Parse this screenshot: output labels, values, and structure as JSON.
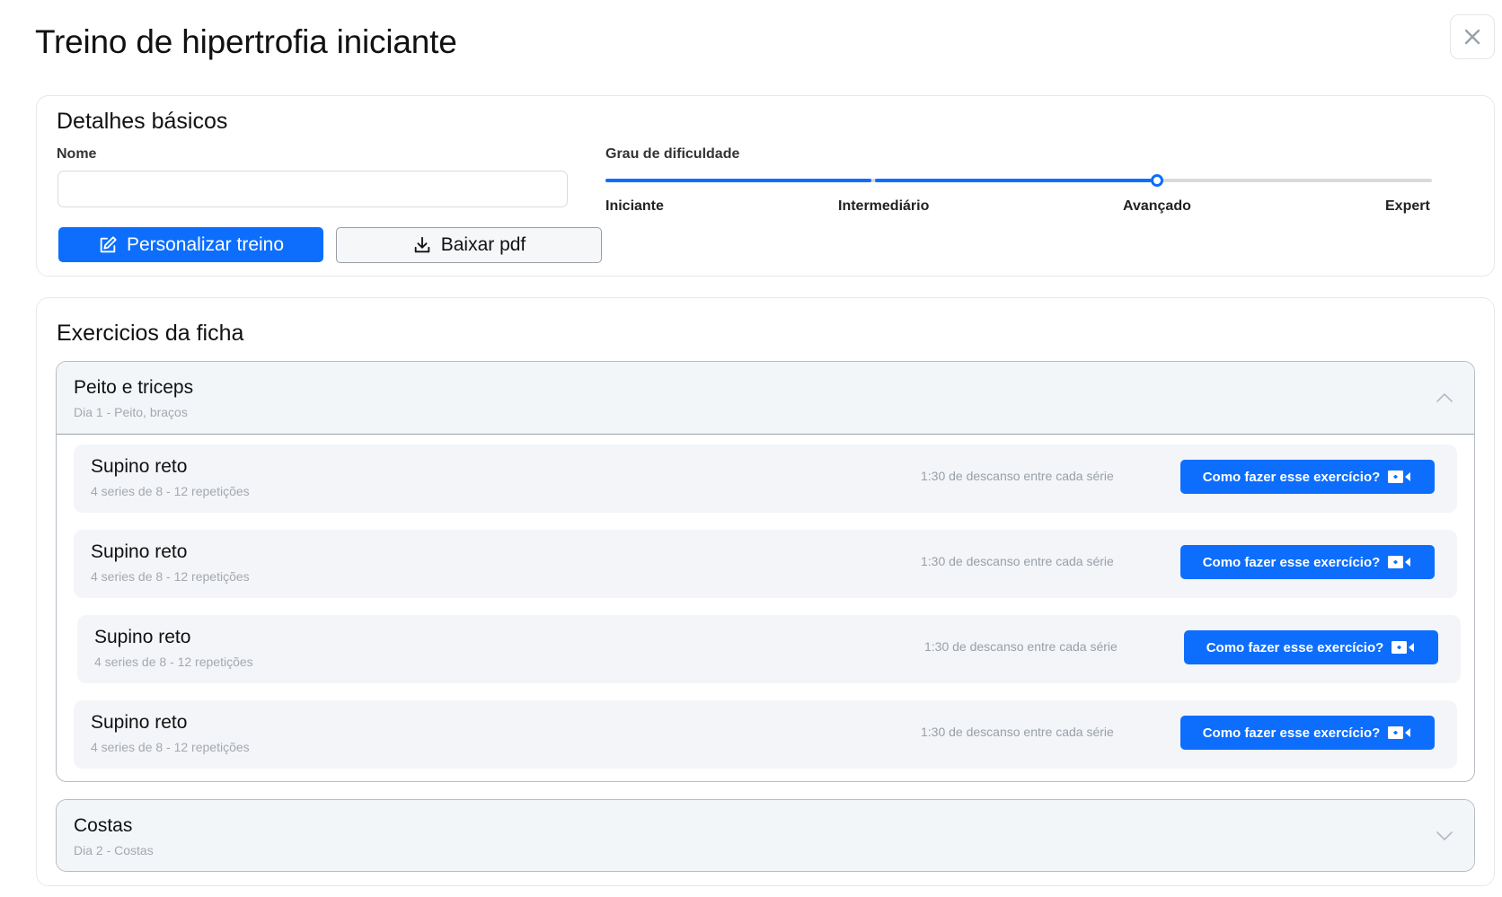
{
  "header": {
    "title": "Treino de hipertrofia iniciante",
    "close_icon": "close-icon"
  },
  "basic": {
    "title": "Detalhes básicos",
    "name_label": "Nome",
    "name_value": "",
    "name_placeholder": "",
    "customize_label": "Personalizar treino",
    "customize_icon": "edit-icon",
    "download_label": "Baixar pdf",
    "download_icon": "download-icon",
    "difficulty_label": "Grau de dificuldade",
    "difficulty_levels": [
      "Iniciante",
      "Intermediário",
      "Avançado",
      "Expert"
    ],
    "difficulty_selected": "Avançado",
    "accent_color": "#0d6efd"
  },
  "exercises": {
    "title": "Exercicios da ficha",
    "groups": [
      {
        "title": "Peito e triceps",
        "subtitle": "Dia 1 - Peito, braços",
        "expanded": true,
        "items": [
          {
            "name": "Supino reto",
            "detail": "4 series de 8 - 12 repetições",
            "rest": "1:30 de descanso entre cada série",
            "button": "Como fazer esse exercício?"
          },
          {
            "name": "Supino reto",
            "detail": "4 series de 8 - 12 repetições",
            "rest": "1:30 de descanso entre cada série",
            "button": "Como fazer esse exercício?"
          },
          {
            "name": "Supino reto",
            "detail": "4 series de 8 - 12 repetições",
            "rest": "1:30 de descanso entre cada série",
            "button": "Como fazer esse exercício?"
          },
          {
            "name": "Supino reto",
            "detail": "4 series de 8 - 12 repetições",
            "rest": "1:30 de descanso entre cada série",
            "button": "Como fazer esse exercício?"
          }
        ]
      },
      {
        "title": "Costas",
        "subtitle": "Dia 2 - Costas",
        "expanded": false,
        "items": []
      }
    ]
  }
}
